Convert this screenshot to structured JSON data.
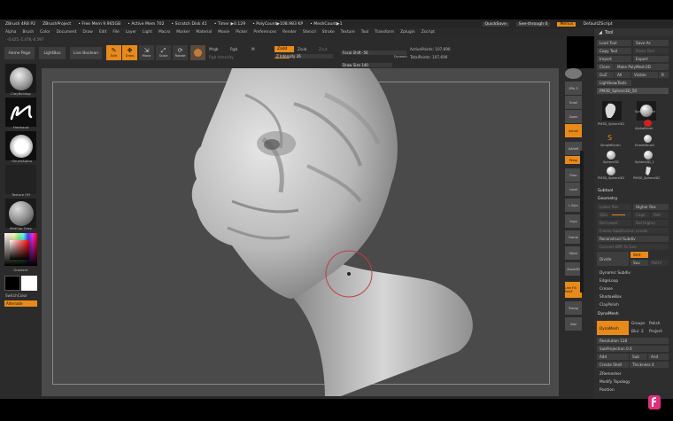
{
  "title_bar": {
    "items": [
      "ZBrush 4R8 P2",
      "ZBrushProject",
      "• Free Mem 9.965GB",
      "• Active Mem 702",
      "• Scratch Disk 41",
      "• Timer ▶0.129",
      "• PolyCount▶108.983 KP",
      "• MeshCount▶1"
    ],
    "quicksave": "QuickSave",
    "seethrough": "See-through  0",
    "menus": "Menus",
    "default_script": "DefaultZScript"
  },
  "menu_bar": [
    "Alpha",
    "Brush",
    "Color",
    "Document",
    "Draw",
    "Edit",
    "File",
    "Layer",
    "Light",
    "Macro",
    "Marker",
    "Material",
    "Movie",
    "Picker",
    "Preferences",
    "Render",
    "Stencil",
    "Stroke",
    "Texture",
    "Tool",
    "Transform",
    "Zplugin",
    "Zscript"
  ],
  "coords": "-0.425,-1.478,-0.597",
  "top_shelf": {
    "home_page": "Home Page",
    "lightbox": "LightBox",
    "live_boolean": "Live Boolean",
    "tools": [
      {
        "label": "Edit",
        "on": true
      },
      {
        "label": "Draw",
        "on": true
      },
      {
        "label": "Move",
        "on": false
      },
      {
        "label": "Scale",
        "on": false
      },
      {
        "label": "Rotate",
        "on": false
      }
    ],
    "mrgb": "Mrgb",
    "rgb": "Rgb",
    "m": "M",
    "rgb_intensity": "Rgb Intensity",
    "zadd": "Zadd",
    "zsub": "Zsub",
    "zcut": "Zcut",
    "z_intensity": "Z Intensity 26",
    "focal_shift": "Focal Shift -56",
    "draw_size": "Draw Size 140",
    "dynamic": "Dynamic",
    "active_points": "ActivePoints: 107,690",
    "total_points": "TotalPoints: 107,690"
  },
  "left_shelf": {
    "brush": "ClayBuildup",
    "stroke": "Freehand",
    "alpha": "~BrushAlpha",
    "texture": "Texture Off",
    "material": "MatCap Gray",
    "gradient": "Gradient",
    "switch_color": "SwitchColor",
    "alternate": "Alternate"
  },
  "right_shelf": [
    "BPR",
    "SPix 3",
    "Scroll",
    "Zoom",
    "Actual",
    "AAHalf",
    "Persp",
    "Floor",
    "Local",
    "L.Sym",
    "Gxyz",
    "Frame",
    "Move",
    "Zoom3D",
    "Rotate",
    "Line Fill PolyF",
    "Transp",
    "Ghost",
    "Solo",
    "Xpose"
  ],
  "tool_panel": {
    "header": "Tool",
    "load_tool": "Load Tool",
    "save_as": "Save As",
    "copy_tool": "Copy Tool",
    "paste_tool": "Paste Tool",
    "import": "Import",
    "export": "Export",
    "clone": "Clone",
    "make_polymesh": "Make PolyMesh3D",
    "goz": "GoZ",
    "all": "All",
    "visible": "Visible",
    "r": "R",
    "lightbox_tools": "Lightbox▸Tools",
    "current_tool": "PM3D_Sphere3D_50",
    "tools": [
      {
        "label": "PM3D_Sphere3D"
      },
      {
        "label": "SphereBrush"
      },
      {
        "label": "AlphaBrush"
      },
      {
        "label": "SimpleBrush"
      },
      {
        "label": "EraserBrush"
      },
      {
        "label": "Sphere3D"
      },
      {
        "label": "Sphere3D_1"
      },
      {
        "label": "PM3D_Sphere3D"
      },
      {
        "label": "PM3D_Sphere3D"
      }
    ],
    "subtool": "Subtool",
    "geometry": "Geometry",
    "lower_res": "Lower Res",
    "higher_res": "Higher Res",
    "sdiv": "SDiv",
    "cage": "Cage",
    "rstr": "Rstr",
    "del_lower": "Del Lower",
    "del_higher": "Del Higher",
    "freeze_subdiv": "Freeze SubDivision Levels",
    "reconstruct_subdiv": "Reconstruct Subdiv",
    "convert_bpr": "Convert BPR To Geo",
    "divide": "Divide",
    "smt": "Smt",
    "suv": "Suv",
    "reuv": "ReUV",
    "dynamic_subdiv": "Dynamic Subdiv",
    "edgeloop": "EdgeLoop",
    "crease": "Crease",
    "shadowbox": "ShadowBox",
    "claypolish": "ClayPolish",
    "dynamesh_section": "DynaMesh",
    "dynamesh_btn": "DynaMesh",
    "groups": "Groups",
    "polish": "Polish",
    "blur": "Blur",
    "blur_val": "2",
    "project": "Project",
    "resolution": "Resolution 128",
    "subprojection": "SubProjection 0.6",
    "add": "Add",
    "sub": "Sub",
    "and": "And",
    "create_shell": "Create Shell",
    "thickness": "Thickness 4",
    "zremesher": "ZRemesher",
    "modify_topology": "Modify Topology",
    "position": "Position"
  },
  "colors": {
    "accent": "#e88a1a",
    "panel": "#2b2b2b",
    "viewport": "#4a4a4a"
  }
}
